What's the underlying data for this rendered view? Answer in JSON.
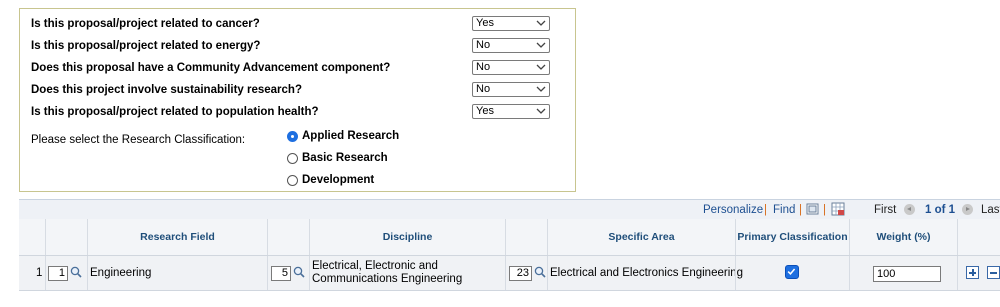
{
  "questions": [
    {
      "label": "Is this proposal/project related to cancer?",
      "value": "Yes"
    },
    {
      "label": "Is this proposal/project related to energy?",
      "value": "No"
    },
    {
      "label": "Does this proposal have a Community Advancement component?",
      "value": "No"
    },
    {
      "label": "Does this project involve sustainability research?",
      "value": "No"
    },
    {
      "label": "Is this proposal/project related to population health?",
      "value": "Yes"
    }
  ],
  "classification": {
    "prompt": "Please select the Research Classification:",
    "options": [
      {
        "label": "Applied Research",
        "selected": true
      },
      {
        "label": "Basic Research",
        "selected": false
      },
      {
        "label": "Development",
        "selected": false
      }
    ]
  },
  "grid": {
    "toolbar": {
      "personalize": "Personalize",
      "sep": "|",
      "find": "Find",
      "first": "First",
      "range": "1 of 1",
      "last": "Last"
    },
    "headers": {
      "research_field": "Research Field",
      "discipline": "Discipline",
      "specific_area": "Specific Area",
      "primary": "Primary Classification",
      "weight": "Weight (%)"
    },
    "rows": [
      {
        "row_num": "1",
        "field_code": "1",
        "field": "Engineering",
        "discipline_code": "5",
        "discipline_line1": "Electrical, Electronic and",
        "discipline_line2": "Communications Engineering",
        "area_code": "23",
        "area": "Electrical and Electronics Engineering",
        "primary": true,
        "weight": "100"
      }
    ]
  },
  "colors": {
    "accent": "#1e6fe0",
    "link": "#1d4f91",
    "header_text": "#1f4e7a",
    "separator": "#d86a17"
  }
}
